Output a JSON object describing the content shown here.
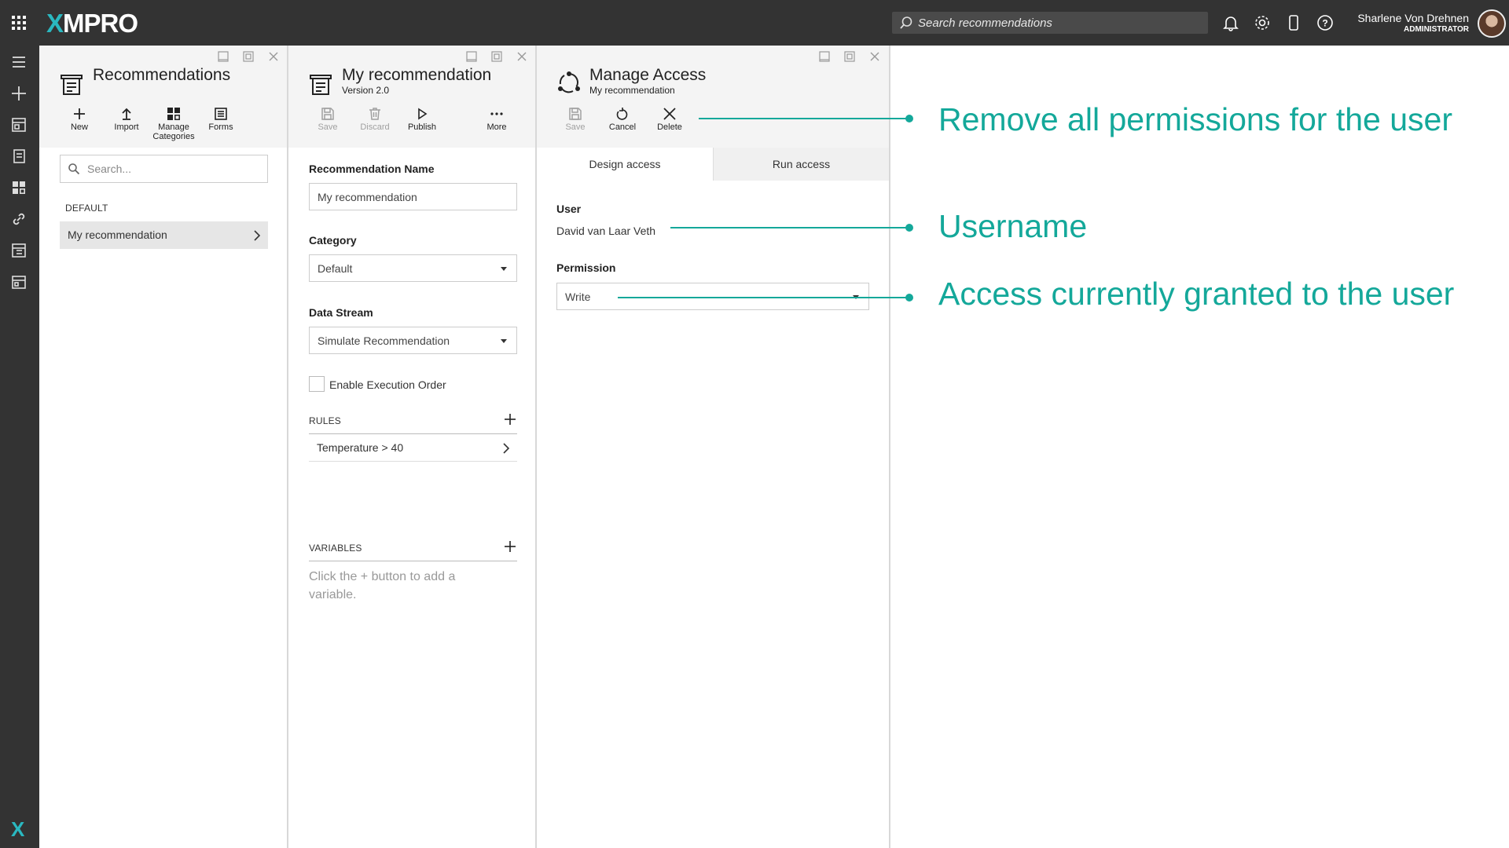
{
  "topbar": {
    "logo_x": "X",
    "logo_rest": "MPRO",
    "search_placeholder": "Search recommendations",
    "user_name": "Sharlene Von Drehnen",
    "user_role": "ADMINISTRATOR"
  },
  "panel1": {
    "title": "Recommendations",
    "toolbar": {
      "new": "New",
      "import": "Import",
      "manage_line1": "Manage",
      "manage_line2": "Categories",
      "forms": "Forms"
    },
    "search_placeholder": "Search...",
    "section": "DEFAULT",
    "items": [
      {
        "label": "My recommendation"
      }
    ]
  },
  "panel2": {
    "title": "My recommendation",
    "subtitle": "Version 2.0",
    "toolbar": {
      "save": "Save",
      "discard": "Discard",
      "publish": "Publish",
      "more": "More"
    },
    "fields": {
      "name_label": "Recommendation Name",
      "name_value": "My recommendation",
      "category_label": "Category",
      "category_value": "Default",
      "stream_label": "Data Stream",
      "stream_value": "Simulate Recommendation",
      "exec_order_label": "Enable Execution Order"
    },
    "rules_label": "RULES",
    "rules": [
      {
        "label": "Temperature > 40"
      }
    ],
    "variables_label": "VARIABLES",
    "variables_hint": "Click the + button to add a variable."
  },
  "panel3": {
    "title": "Manage Access",
    "subtitle": "My recommendation",
    "toolbar": {
      "save": "Save",
      "cancel": "Cancel",
      "delete": "Delete"
    },
    "tabs": [
      {
        "label": "Design access"
      },
      {
        "label": "Run access"
      }
    ],
    "user_label": "User",
    "user_value": "David van Laar Veth",
    "permission_label": "Permission",
    "permission_value": "Write"
  },
  "annotations": [
    {
      "text": "Remove all permissions for the user"
    },
    {
      "text": "Username"
    },
    {
      "text": "Access currently granted to the user"
    }
  ],
  "colors": {
    "accent": "#14a89a",
    "brand": "#2ab8c0",
    "chrome": "#333333"
  }
}
